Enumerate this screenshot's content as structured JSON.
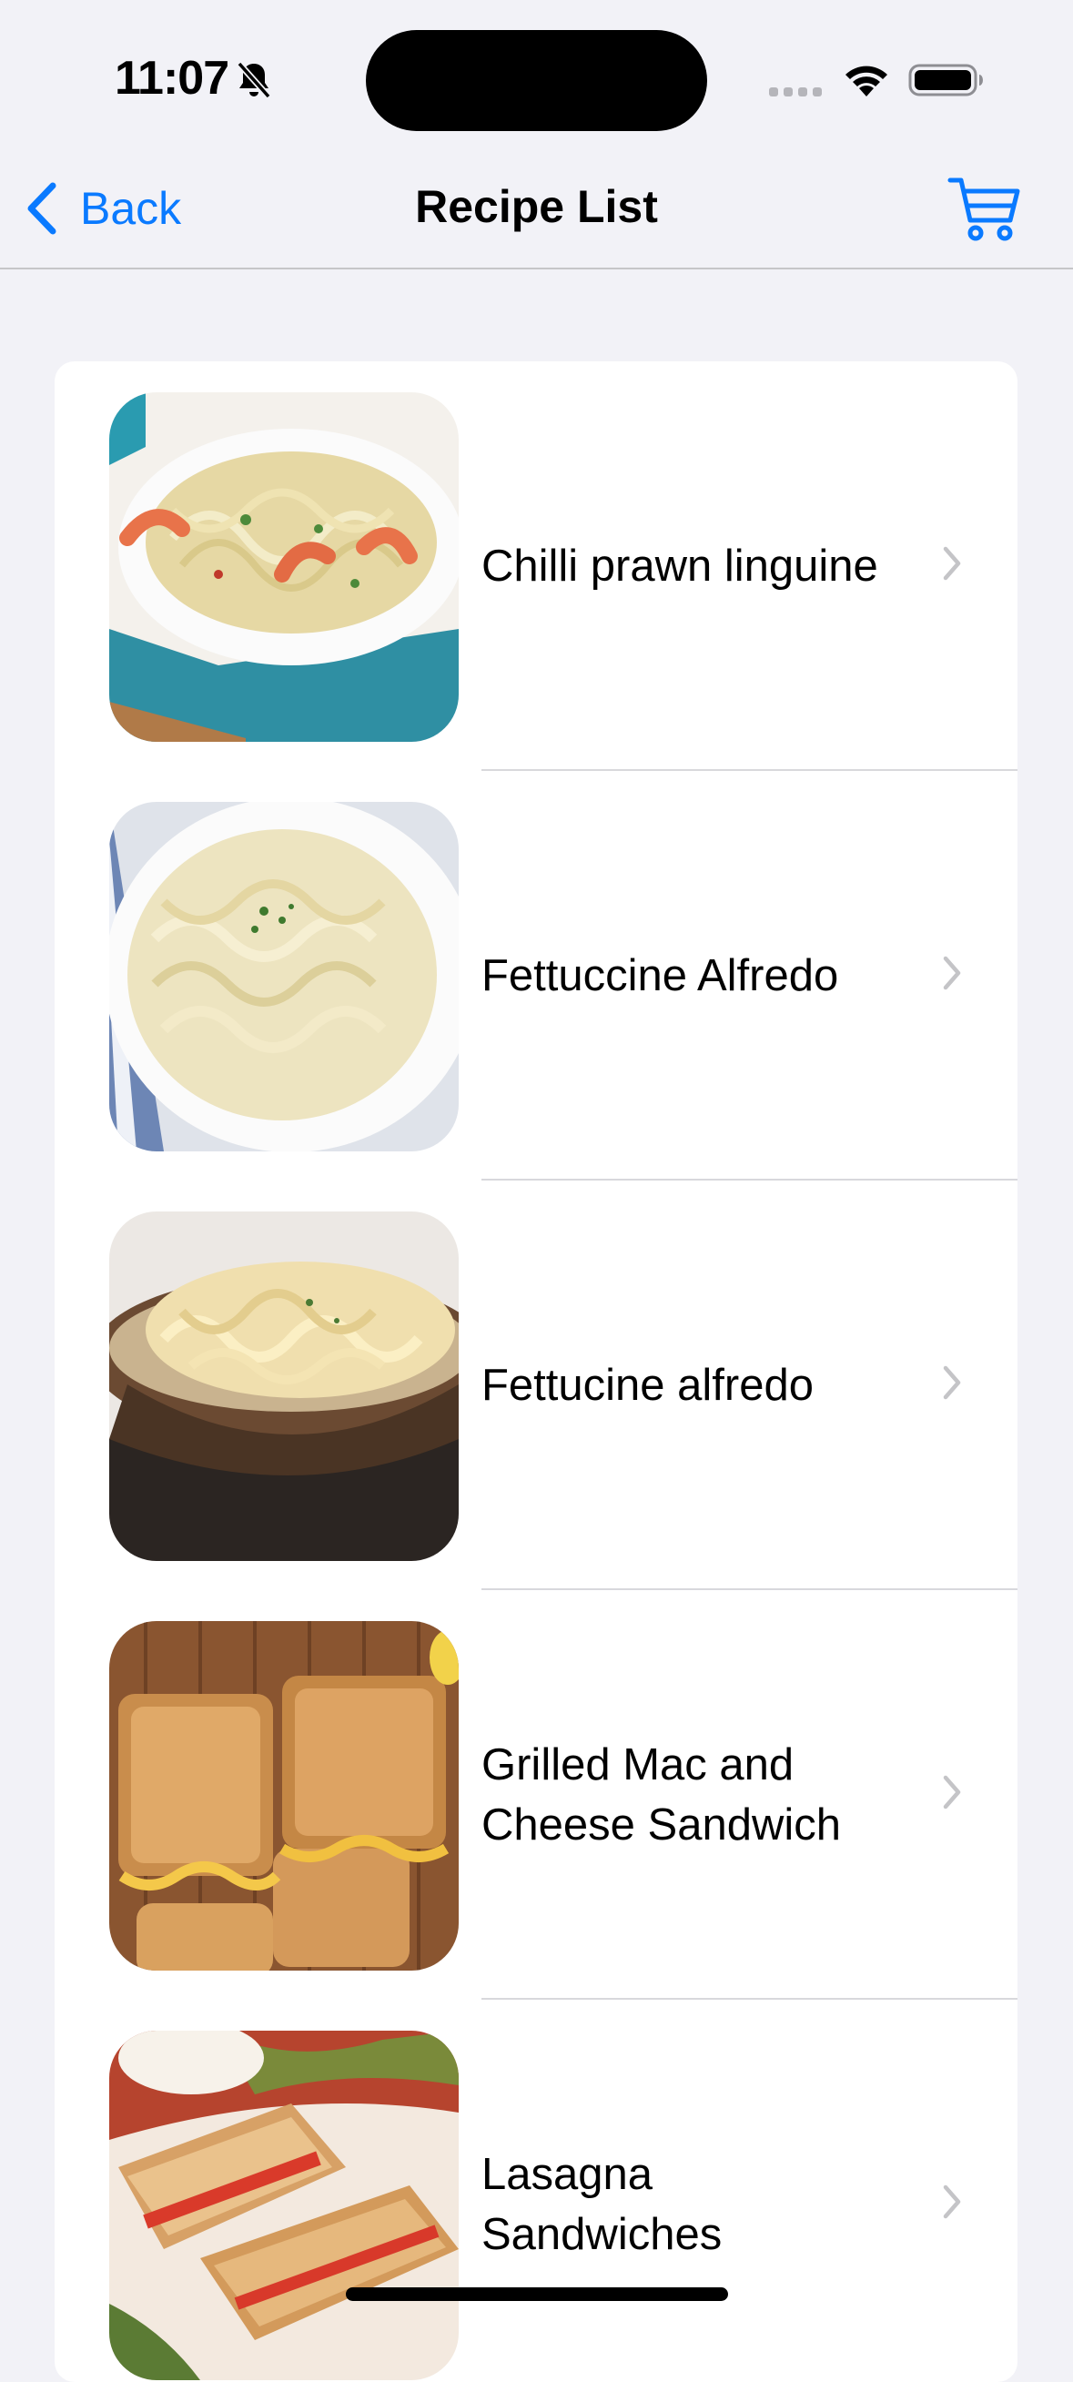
{
  "status_bar": {
    "time": "11:07"
  },
  "nav": {
    "back_label": "Back",
    "title": "Recipe List"
  },
  "recipes": [
    {
      "name": "Chilli prawn linguine"
    },
    {
      "name": "Fettuccine Alfredo"
    },
    {
      "name": "Fettucine alfredo"
    },
    {
      "name": "Grilled Mac and Cheese Sandwich"
    },
    {
      "name": "Lasagna Sandwiches"
    }
  ],
  "colors": {
    "accent": "#0a7aff",
    "background": "#f2f2f7",
    "card": "#ffffff",
    "separator": "#d8d8dc",
    "chevron": "#c4c4c7"
  }
}
